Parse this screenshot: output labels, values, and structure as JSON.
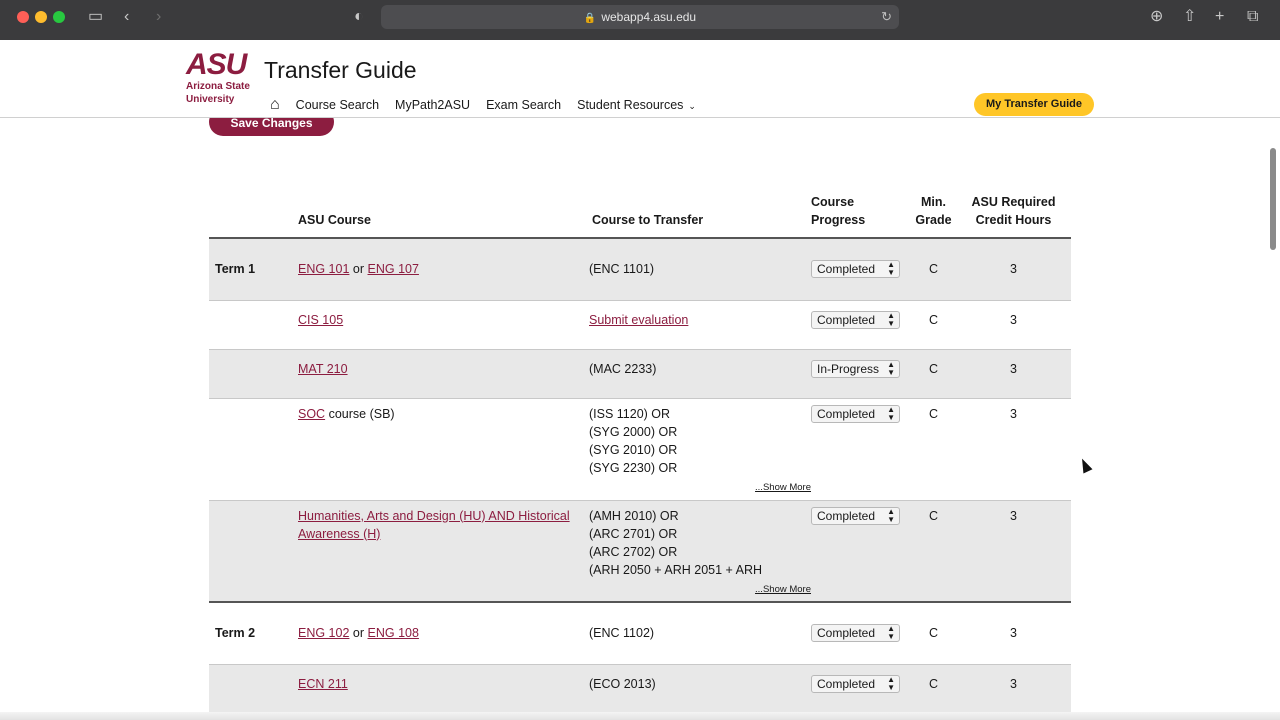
{
  "browser": {
    "url": "webapp4.asu.edu"
  },
  "header": {
    "logo_mark": "ASU",
    "logo_line1": "Arizona State",
    "logo_line2": "University",
    "title": "Transfer Guide",
    "nav": {
      "course_search": "Course Search",
      "mypath": "MyPath2ASU",
      "exam_search": "Exam Search",
      "student_resources": "Student Resources"
    },
    "my_transfer_guide": "My Transfer Guide"
  },
  "save_label": "Save Changes",
  "table": {
    "headers": {
      "asu_course": "ASU Course",
      "course_to_transfer": "Course to Transfer",
      "progress_1": "Course",
      "progress_2": "Progress",
      "min_1": "Min.",
      "min_2": "Grade",
      "hours_1": "ASU Required",
      "hours_2": "Credit Hours"
    },
    "rows": [
      {
        "term": "Term 1",
        "asu_a": "ENG 101",
        "asu_join": "or",
        "asu_b": "ENG 107",
        "transfer": "(ENC 1101)",
        "progress": "Completed",
        "grade": "C",
        "hours": "3"
      },
      {
        "asu_a": "CIS 105",
        "transfer_link": "Submit evaluation",
        "progress": "Completed",
        "grade": "C",
        "hours": "3"
      },
      {
        "asu_a": "MAT 210",
        "transfer": "(MAC 2233)",
        "progress": "In-Progress",
        "grade": "C",
        "hours": "3"
      },
      {
        "asu_a": "SOC",
        "asu_suffix": "course (SB)",
        "transfer_lines": [
          "(ISS 1120) OR",
          "(SYG 2000) OR",
          "(SYG 2010) OR",
          "(SYG 2230) OR"
        ],
        "show_more": "...Show More",
        "progress": "Completed",
        "grade": "C",
        "hours": "3"
      },
      {
        "asu_a": "Humanities, Arts and Design (HU) AND Historical Awareness (H)",
        "transfer_lines": [
          "(AMH 2010) OR",
          "(ARC 2701) OR",
          "(ARC 2702) OR",
          "(ARH 2050 + ARH 2051 + ARH"
        ],
        "show_more": "...Show More",
        "progress": "Completed",
        "grade": "C",
        "hours": "3"
      },
      {
        "term": "Term 2",
        "asu_a": "ENG 102",
        "asu_join": "or",
        "asu_b": "ENG 108",
        "transfer": "(ENC 1102)",
        "progress": "Completed",
        "grade": "C",
        "hours": "3"
      },
      {
        "asu_a": "ECN 211",
        "transfer": "(ECO 2013)",
        "progress": "Completed",
        "grade": "C",
        "hours": "3"
      }
    ]
  }
}
